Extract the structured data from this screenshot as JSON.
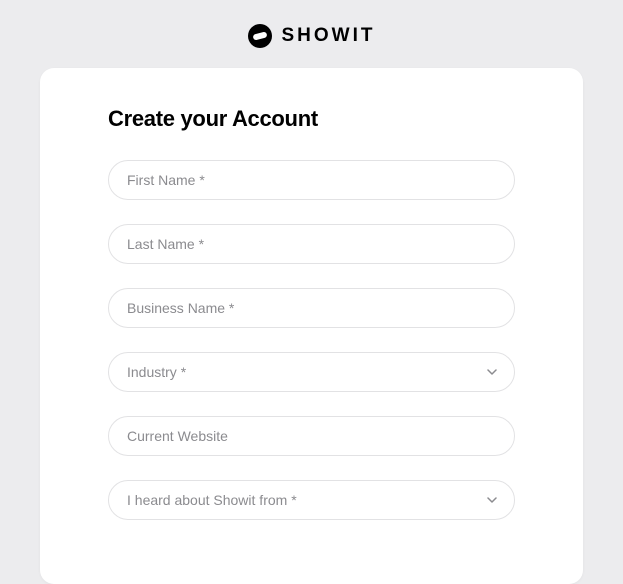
{
  "brand": {
    "name": "SHOWIT"
  },
  "form": {
    "heading": "Create your Account",
    "fields": {
      "firstName": {
        "placeholder": "First Name *"
      },
      "lastName": {
        "placeholder": "Last Name *"
      },
      "businessName": {
        "placeholder": "Business Name *"
      },
      "industry": {
        "placeholder": "Industry *"
      },
      "currentWebsite": {
        "placeholder": "Current Website"
      },
      "heardFrom": {
        "placeholder": "I heard about Showit from *"
      }
    }
  }
}
